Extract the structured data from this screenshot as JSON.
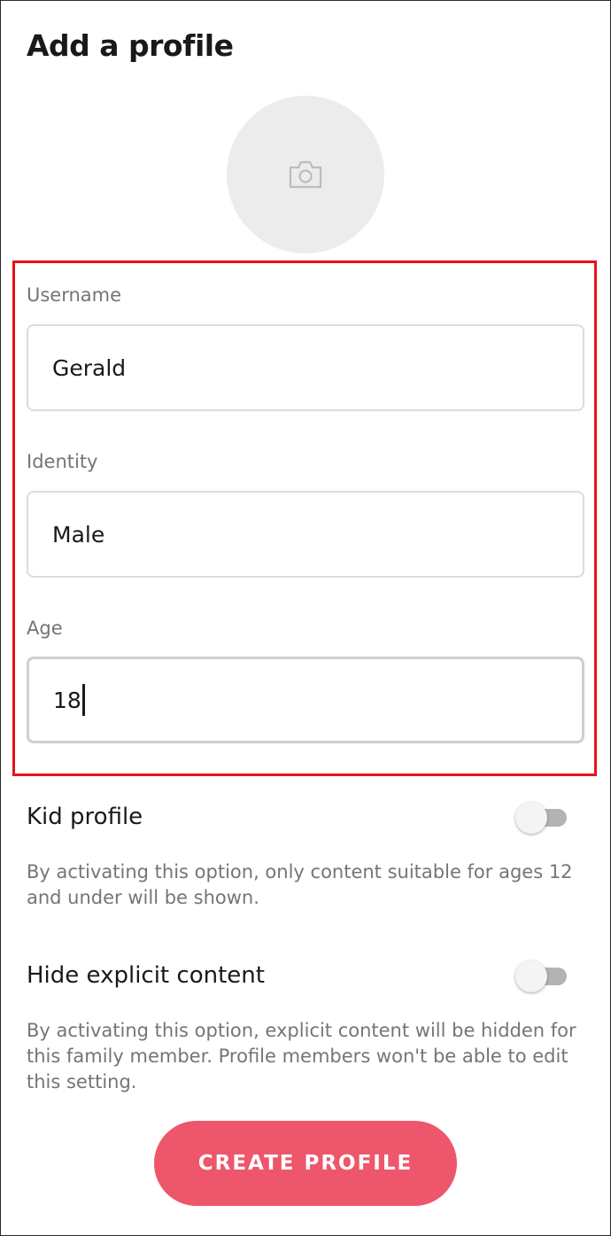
{
  "page": {
    "title": "Add a profile"
  },
  "avatar": {
    "icon": "camera-icon"
  },
  "form": {
    "username": {
      "label": "Username",
      "value": "Gerald"
    },
    "identity": {
      "label": "Identity",
      "value": "Male"
    },
    "age": {
      "label": "Age",
      "value": "18"
    }
  },
  "kid_profile": {
    "label": "Kid profile",
    "description": "By activating this option, only content suitable for ages 12 and under will be shown.",
    "enabled": false
  },
  "hide_explicit": {
    "label": "Hide explicit content",
    "description": "By activating this option, explicit content will be hidden for this family member. Profile members won't be able to edit this setting.",
    "enabled": false
  },
  "actions": {
    "create_label": "CREATE PROFILE"
  },
  "colors": {
    "accent": "#ee566b",
    "highlight_border": "#e5131b",
    "label_gray": "#757575"
  }
}
